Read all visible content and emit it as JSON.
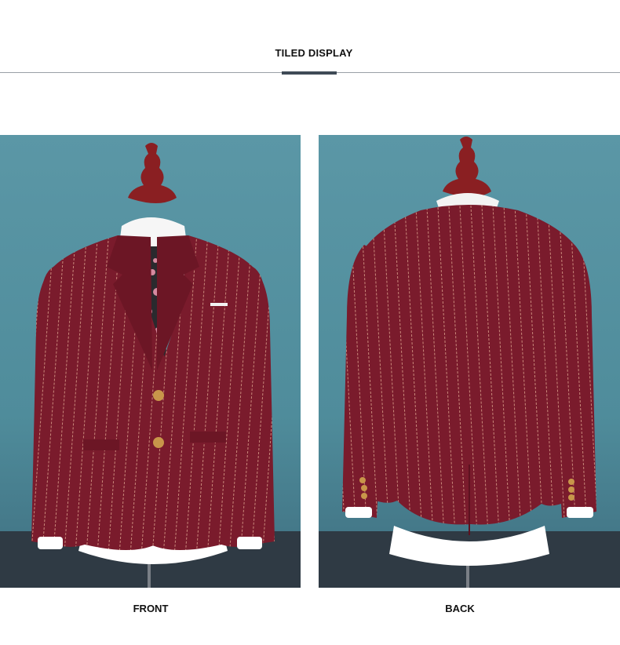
{
  "header": {
    "title": "TILED DISPLAY"
  },
  "photos": [
    {
      "caption": "FRONT",
      "subject": "burgundy-pinstripe-suit-jacket-front"
    },
    {
      "caption": "BACK",
      "subject": "burgundy-pinstripe-suit-jacket-back"
    }
  ],
  "colors": {
    "jacket": "#7a1b2c",
    "pinstripe": "#c9887a",
    "backdrop": "#5b97a6",
    "floor": "#2f3a44",
    "mannequin": "#8a1f22",
    "shirt": "#ffffff",
    "button": "#c8964a",
    "accent_bar": "#3f4a56"
  }
}
